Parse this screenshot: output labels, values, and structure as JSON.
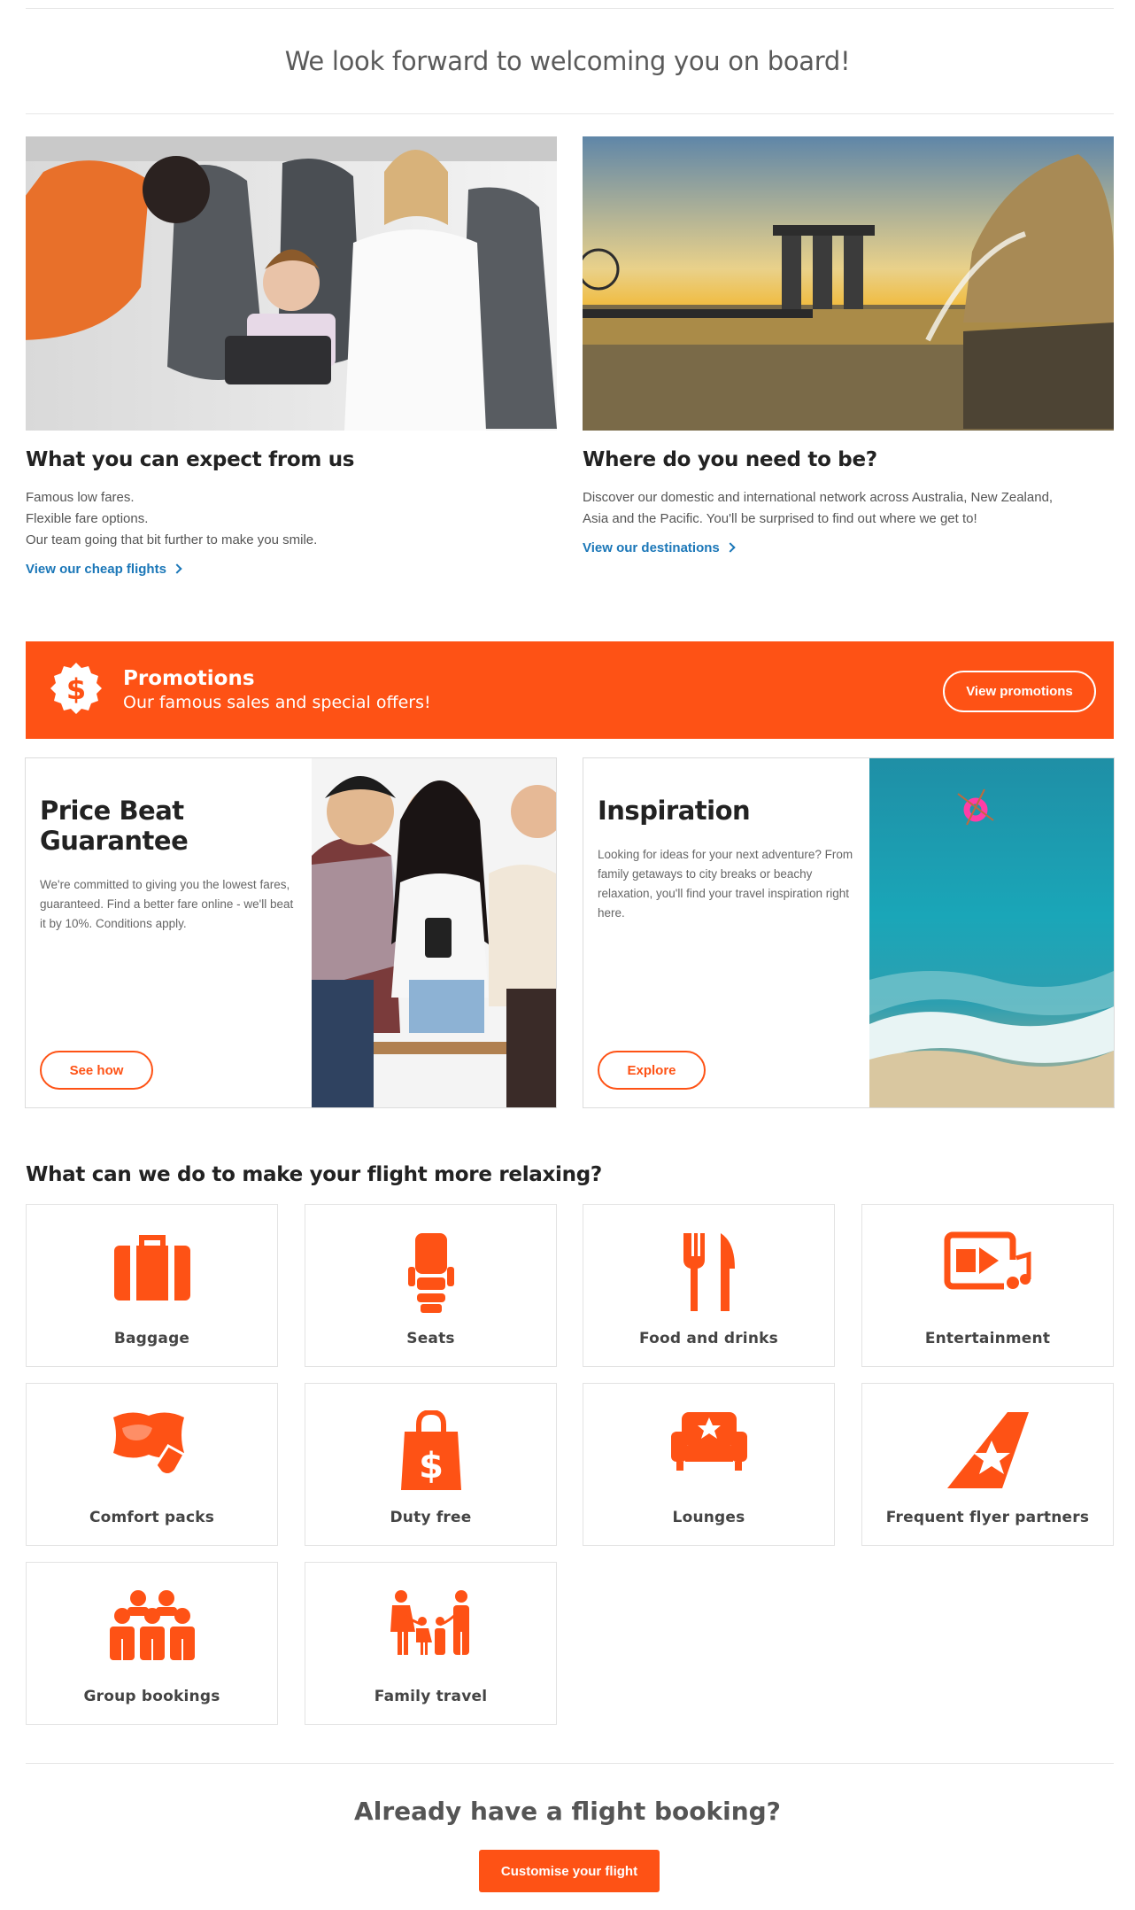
{
  "welcome": "We look forward to welcoming you on board!",
  "features": [
    {
      "title": "What you can expect from us",
      "body": "Famous low fares.\nFlexible fare options.\nOur team going that bit further to make you smile.",
      "link": "View our cheap flights"
    },
    {
      "title": "Where do you need to be?",
      "body": "Discover our domestic and international network across Australia, New Zealand,\nAsia and the Pacific. You'll be surprised to find out where we get to!",
      "link": "View our destinations"
    }
  ],
  "promo": {
    "icon": "dollar-badge-icon",
    "title": "Promotions",
    "subtitle": "Our famous sales and special offers!",
    "button": "View promotions"
  },
  "cards": [
    {
      "title": "Price Beat Guarantee",
      "body": "We're committed to giving you the lowest fares, guaranteed. Find a better fare online - we'll beat it by 10%. Conditions apply.",
      "button": "See how"
    },
    {
      "title": "Inspiration",
      "body": "Looking for ideas for your next adventure? From family getaways to city breaks or beachy relaxation, you'll find your travel inspiration right here.",
      "button": "Explore"
    }
  ],
  "relax": {
    "title": "What can we do to make your flight more relaxing?",
    "items": [
      {
        "label": "Baggage",
        "icon": "suitcase-icon"
      },
      {
        "label": "Seats",
        "icon": "seat-icon"
      },
      {
        "label": "Food and drinks",
        "icon": "fork-knife-icon"
      },
      {
        "label": "Entertainment",
        "icon": "entertainment-icon"
      },
      {
        "label": "Comfort packs",
        "icon": "comfort-pack-icon"
      },
      {
        "label": "Duty free",
        "icon": "shopping-bag-icon"
      },
      {
        "label": "Lounges",
        "icon": "lounge-icon"
      },
      {
        "label": "Frequent flyer partners",
        "icon": "tail-star-icon"
      },
      {
        "label": "Group bookings",
        "icon": "group-icon"
      },
      {
        "label": "Family travel",
        "icon": "family-icon"
      }
    ]
  },
  "booking": {
    "title": "Already have a flight booking?",
    "button": "Customise your flight"
  },
  "colors": {
    "accent": "#fe5215",
    "link": "#1b77b8"
  }
}
